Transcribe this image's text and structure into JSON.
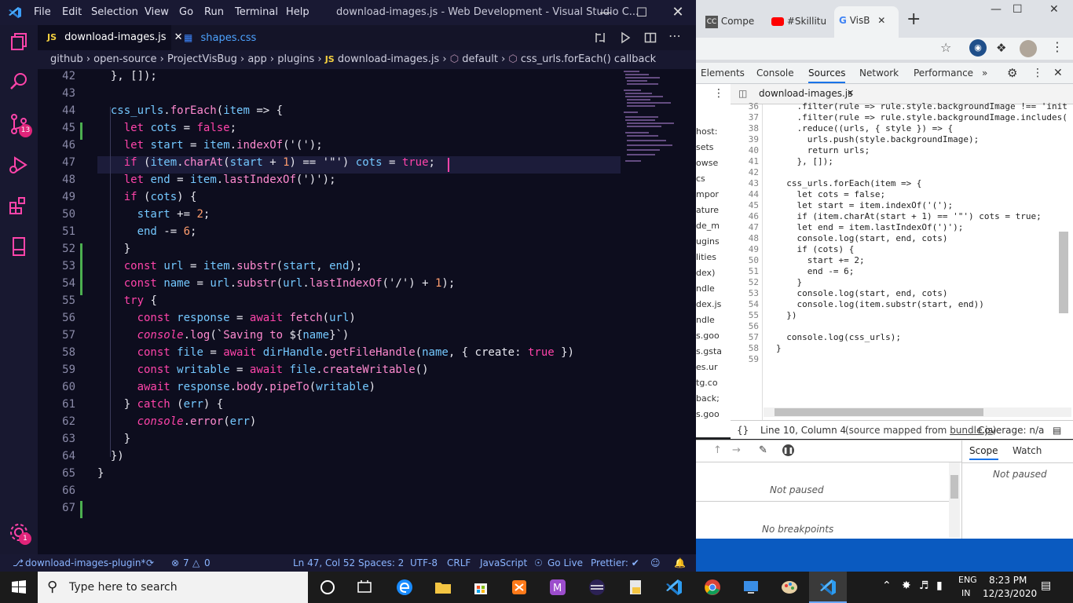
{
  "vscode": {
    "menu": [
      "File",
      "Edit",
      "Selection",
      "View",
      "Go",
      "Run",
      "Terminal",
      "Help"
    ],
    "window_title": "download-images.js - Web Development - Visual Studio C...",
    "tabs": [
      {
        "icon": "JS",
        "label": "download-images.js",
        "active": true
      },
      {
        "icon": "css",
        "label": "shapes.css",
        "active": false
      }
    ],
    "breadcrumb": [
      "github",
      "open-source",
      "ProjectVisBug",
      "app",
      "plugins",
      "download-images.js",
      "default",
      "css_urls.forEach() callback"
    ],
    "badges": {
      "source_control": "13",
      "settings": "1"
    },
    "code_lines": [
      {
        "n": "42",
        "text": "  }, []);"
      },
      {
        "n": "43",
        "text": ""
      },
      {
        "n": "44",
        "text": "  css_urls.forEach(item => {"
      },
      {
        "n": "45",
        "text": "    let cots = false;"
      },
      {
        "n": "46",
        "text": "    let start = item.indexOf('(');"
      },
      {
        "n": "47",
        "text": "    if (item.charAt(start + 1) == '\"') cots = true;"
      },
      {
        "n": "48",
        "text": "    let end = item.lastIndexOf(')');"
      },
      {
        "n": "49",
        "text": "    if (cots) {"
      },
      {
        "n": "50",
        "text": "      start += 2;"
      },
      {
        "n": "51",
        "text": "      end -= 6;"
      },
      {
        "n": "52",
        "text": "    }"
      },
      {
        "n": "53",
        "text": "    const url = item.substr(start, end);"
      },
      {
        "n": "54",
        "text": "    const name = url.substr(url.lastIndexOf('/') + 1);"
      },
      {
        "n": "55",
        "text": "    try {"
      },
      {
        "n": "56",
        "text": "      const response = await fetch(url)"
      },
      {
        "n": "57",
        "text": "      console.log(`Saving to ${name}`)"
      },
      {
        "n": "58",
        "text": "      const file = await dirHandle.getFileHandle(name, { create: true })"
      },
      {
        "n": "59",
        "text": "      const writable = await file.createWritable()"
      },
      {
        "n": "60",
        "text": "      await response.body.pipeTo(writable)"
      },
      {
        "n": "61",
        "text": "    } catch (err) {"
      },
      {
        "n": "62",
        "text": "      console.error(err)"
      },
      {
        "n": "63",
        "text": "    }"
      },
      {
        "n": "64",
        "text": "  })"
      },
      {
        "n": "65",
        "text": "}"
      },
      {
        "n": "66",
        "text": ""
      },
      {
        "n": "67",
        "text": ""
      }
    ],
    "status": {
      "branch": "download-images-plugin*",
      "errors": "7",
      "warnings": "0",
      "position": "Ln 47, Col 52",
      "spaces": "Spaces: 2",
      "encoding": "UTF-8",
      "eol": "CRLF",
      "language": "JavaScript",
      "golive": "Go Live",
      "prettier": "Prettier: ✔"
    }
  },
  "chrome": {
    "tabs": [
      {
        "label": "Compe"
      },
      {
        "label": "#Skillitu"
      },
      {
        "label": "VisB"
      }
    ],
    "devtools_tabs": [
      "Elements",
      "Console",
      "Sources",
      "Network",
      "Performance"
    ],
    "active_devtools_tab": "Sources",
    "source_file": "download-images.js",
    "left_panel_fragments": [
      "host:",
      "sets",
      "owse",
      "cs",
      "mpor",
      "ature",
      "de_m",
      "ugins",
      "lities",
      "dex)",
      "ndle",
      "dex.js",
      "ndle",
      "s.goo",
      "s.gsta",
      "es.ur",
      "tg.co",
      "back;",
      "s.goo"
    ],
    "source_lines": [
      {
        "n": "36",
        "text": "    .filter(rule => rule.style.backgroundImage !== 'init"
      },
      {
        "n": "37",
        "text": "    .filter(rule => rule.style.backgroundImage.includes("
      },
      {
        "n": "38",
        "text": "    .reduce((urls, { style }) => {"
      },
      {
        "n": "39",
        "text": "      urls.push(style.backgroundImage);"
      },
      {
        "n": "40",
        "text": "      return urls;"
      },
      {
        "n": "41",
        "text": "    }, []);"
      },
      {
        "n": "42",
        "text": ""
      },
      {
        "n": "43",
        "text": "  css_urls.forEach(item => {"
      },
      {
        "n": "44",
        "text": "    let cots = false;"
      },
      {
        "n": "45",
        "text": "    let start = item.indexOf('(');"
      },
      {
        "n": "46",
        "text": "    if (item.charAt(start + 1) == '\"') cots = true;"
      },
      {
        "n": "47",
        "text": "    let end = item.lastIndexOf(')');"
      },
      {
        "n": "48",
        "text": "    console.log(start, end, cots)"
      },
      {
        "n": "49",
        "text": "    if (cots) {"
      },
      {
        "n": "50",
        "text": "      start += 2;"
      },
      {
        "n": "51",
        "text": "      end -= 6;"
      },
      {
        "n": "52",
        "text": "    }"
      },
      {
        "n": "53",
        "text": "    console.log(start, end, cots)"
      },
      {
        "n": "54",
        "text": "    console.log(item.substr(start, end))"
      },
      {
        "n": "55",
        "text": "  })"
      },
      {
        "n": "56",
        "text": ""
      },
      {
        "n": "57",
        "text": "  console.log(css_urls);"
      },
      {
        "n": "58",
        "text": "}"
      },
      {
        "n": "59",
        "text": ""
      }
    ],
    "status_line": "Line 10, Column 4",
    "source_mapped_prefix": "(source mapped from ",
    "source_mapped_link": "bundle.js",
    "source_mapped_suffix": ")",
    "coverage": "Coverage: n/a",
    "scope_tab": "Scope",
    "watch_tab": "Watch",
    "not_paused_left": "Not paused",
    "not_paused_right": "Not paused",
    "no_breakpoints": "No breakpoints"
  },
  "taskbar": {
    "search_placeholder": "Type here to search",
    "lang_line1": "ENG",
    "lang_line2": "IN",
    "time": "8:23 PM",
    "date": "12/23/2020"
  }
}
